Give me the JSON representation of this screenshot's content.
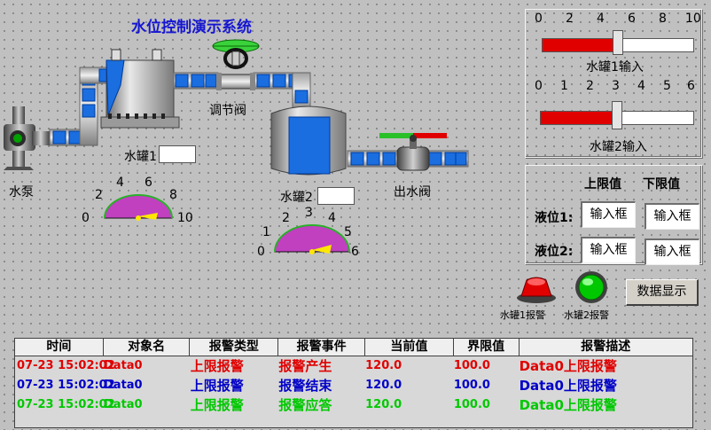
{
  "title": "水位控制演示系统",
  "labels": {
    "valve_control": "调节阀",
    "tank1": "水罐1",
    "tank2": "水罐2",
    "pump": "水泵",
    "outlet_valve": "出水阀"
  },
  "gauge1": {
    "ticks": [
      "0",
      "2",
      "4",
      "6",
      "8",
      "10"
    ]
  },
  "gauge2": {
    "ticks": [
      "0",
      "1",
      "2",
      "3",
      "4",
      "5",
      "6"
    ]
  },
  "slider1": {
    "ticks": [
      "0",
      "2",
      "4",
      "6",
      "8",
      "10"
    ],
    "value": 5.0,
    "max": 10,
    "label": "水罐1输入"
  },
  "slider2": {
    "ticks": [
      "0",
      "1",
      "2",
      "3",
      "4",
      "5",
      "6"
    ],
    "value": 3.0,
    "max": 6,
    "label": "水罐2输入"
  },
  "limits": {
    "upper_header": "上限值",
    "lower_header": "下限值",
    "level1_label": "液位1:",
    "level2_label": "液位2:",
    "input_text": "输入框"
  },
  "alarms": {
    "tank1": "水罐1报警",
    "tank2": "水罐2报警",
    "tank1_color": "#e00000",
    "tank2_color": "#00c800"
  },
  "data_button": "数据显示",
  "table": {
    "columns": [
      "时间",
      "对象名",
      "报警类型",
      "报警事件",
      "当前值",
      "界限值",
      "报警描述"
    ],
    "rows": [
      {
        "time": "07-23 15:02:02",
        "object": "Data0",
        "type": "上限报警",
        "event": "报警产生",
        "current": "120.0",
        "limit": "100.0",
        "desc": "Data0上限报警",
        "color": "#e00000"
      },
      {
        "time": "07-23 15:02:02",
        "object": "Data0",
        "type": "上限报警",
        "event": "报警结束",
        "current": "120.0",
        "limit": "100.0",
        "desc": "Data0上限报警",
        "color": "#0000c8"
      },
      {
        "time": "07-23 15:02:02",
        "object": "Data0",
        "type": "上限报警",
        "event": "报警应答",
        "current": "120.0",
        "limit": "100.0",
        "desc": "Data0上限报警",
        "color": "#00c800"
      }
    ]
  }
}
